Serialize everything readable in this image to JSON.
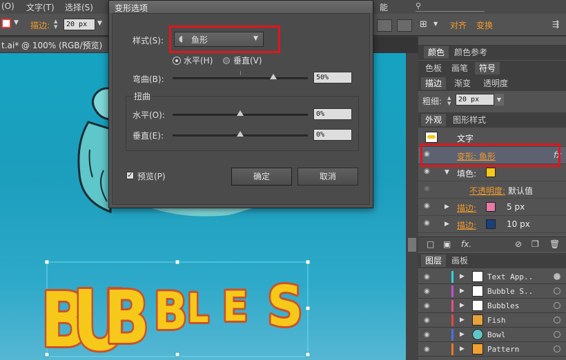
{
  "menubar": {
    "items": [
      "(O)",
      "文字(T)",
      "选择(S)"
    ]
  },
  "controlbar": {
    "stroke_label": "描边:",
    "stroke_value": "20 px",
    "align_label": "对齐",
    "transform_label": "变换",
    "right_label": "能"
  },
  "document": {
    "tab_title": "t.ai* @ 100% (RGB/预览)",
    "close": "×"
  },
  "dialog": {
    "title": "变形选项",
    "style_label": "样式(S):",
    "style_value": "鱼形",
    "horizontal_label": "水平(H)",
    "vertical_label": "垂直(V)",
    "bend_label": "弯曲(B):",
    "bend_value": "50%",
    "distortion_label": "扭曲",
    "dist_h_label": "水平(O):",
    "dist_h_value": "0%",
    "dist_v_label": "垂直(E):",
    "dist_v_value": "0%",
    "preview_label": "预览(P)",
    "ok_label": "确定",
    "cancel_label": "取消"
  },
  "panels": {
    "color_tabs": [
      "颜色",
      "颜色参考"
    ],
    "swatch_tabs": [
      "色板",
      "画笔",
      "符号"
    ],
    "stroke_tabs": [
      "描边",
      "渐变",
      "透明度"
    ],
    "weight_label": "粗细:",
    "weight_value": "20 px",
    "appearance_tabs": [
      "外观",
      "图形样式"
    ],
    "appearance": {
      "title": "文字",
      "warp": "变形: 鱼形",
      "fx": "fx",
      "fill_label": "填色:",
      "fill_color": "#f5c81a",
      "opacity_label": "不透明度:",
      "opacity_value": "默认值",
      "stroke1_label": "描边:",
      "stroke1_value": "5 px",
      "stroke1_color": "#e87aa8",
      "stroke2_label": "描边:",
      "stroke2_value": "10 px",
      "stroke2_color": "#1a3f7a"
    },
    "layers_tabs": [
      "图层",
      "画板"
    ],
    "layers": [
      {
        "name": "Text App..",
        "color": "#2ad4e6"
      },
      {
        "name": "Bubble S..",
        "color": "#c24fd6"
      },
      {
        "name": "Bubbles",
        "color": "#e64f8a"
      },
      {
        "name": "Fish",
        "color": "#e04848"
      },
      {
        "name": "Bowl",
        "color": "#4f6de6"
      },
      {
        "name": "Pattern",
        "color": "#e67a2a"
      }
    ]
  },
  "artwork": {
    "text": "BUBBLES"
  }
}
